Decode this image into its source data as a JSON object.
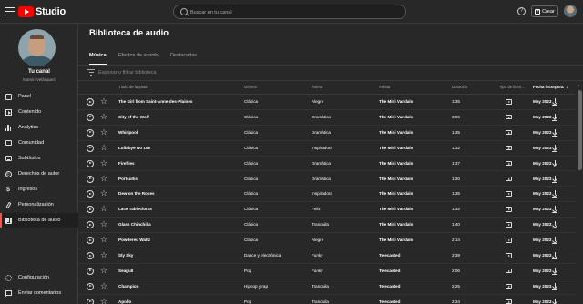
{
  "app": {
    "logo_text": "Studio",
    "search_placeholder": "Buscar en tu canal",
    "help_glyph": "?",
    "create_label": "Crear"
  },
  "channel": {
    "name": "Tu canal",
    "handle": "Marvin Velásquez"
  },
  "sidebar": {
    "items": [
      {
        "label": "Panel",
        "icon": "dashboard-icon"
      },
      {
        "label": "Contenido",
        "icon": "content-icon"
      },
      {
        "label": "Analytics",
        "icon": "analytics-icon"
      },
      {
        "label": "Comunidad",
        "icon": "community-icon"
      },
      {
        "label": "Subtítulos",
        "icon": "subtitles-icon"
      },
      {
        "label": "Derechos de autor",
        "icon": "copyright-icon"
      },
      {
        "label": "Ingresos",
        "icon": "earn-icon"
      },
      {
        "label": "Personalización",
        "icon": "customization-icon"
      },
      {
        "label": "Biblioteca de audio",
        "icon": "audio-library-icon",
        "active": true
      }
    ],
    "bottom": [
      {
        "label": "Configuración",
        "icon": "settings-icon"
      },
      {
        "label": "Enviar comentarios",
        "icon": "feedback-icon"
      }
    ]
  },
  "main": {
    "title": "Biblioteca de audio",
    "tabs": [
      {
        "label": "Música",
        "active": true
      },
      {
        "label": "Efectos de sonido"
      },
      {
        "label": "Destacadas"
      }
    ],
    "filter_placeholder": "Explorar o filtrar biblioteca",
    "columns": {
      "title": "Título de la pista",
      "genre": "Género",
      "mood": "Ánimo",
      "artist": "Artista",
      "duration": "Duración",
      "type": "Tipo de licen...",
      "date": "Fecha incorpora...",
      "sort_glyph": "↓"
    },
    "tracks": [
      {
        "title": "The Girl from Saint-Anne-des-Plaines",
        "genre": "Clásica",
        "mood": "Alegre",
        "artist": "The Mini Vandals",
        "duration": "1:35",
        "date": "May 2023"
      },
      {
        "title": "City of the Wolf",
        "genre": "Clásica",
        "mood": "Dramática",
        "artist": "The Mini Vandals",
        "duration": "3:06",
        "date": "May 2023"
      },
      {
        "title": "Whirlpool",
        "genre": "Clásica",
        "mood": "Dramática",
        "artist": "The Mini Vandals",
        "duration": "1:35",
        "date": "May 2023"
      },
      {
        "title": "Lullabye No 108",
        "genre": "Clásica",
        "mood": "Inspiradora",
        "artist": "The Mini Vandals",
        "duration": "1:32",
        "date": "May 2023"
      },
      {
        "title": "Fireflies",
        "genre": "Clásica",
        "mood": "Dramática",
        "artist": "The Mini Vandals",
        "duration": "1:37",
        "date": "May 2023"
      },
      {
        "title": "Portcullis",
        "genre": "Clásica",
        "mood": "Dramática",
        "artist": "The Mini Vandals",
        "duration": "1:30",
        "date": "May 2023"
      },
      {
        "title": "Dew on the Roses",
        "genre": "Clásica",
        "mood": "Inspiradora",
        "artist": "The Mini Vandals",
        "duration": "1:35",
        "date": "May 2023"
      },
      {
        "title": "Lace Tablecloths",
        "genre": "Clásica",
        "mood": "Feliz",
        "artist": "The Mini Vandals",
        "duration": "1:32",
        "date": "May 2023"
      },
      {
        "title": "Glass Chinchilla",
        "genre": "Clásica",
        "mood": "Tranquila",
        "artist": "The Mini Vandals",
        "duration": "1:40",
        "date": "May 2023"
      },
      {
        "title": "Powdered Waltz",
        "genre": "Clásica",
        "mood": "Alegre",
        "artist": "The Mini Vandals",
        "duration": "2:14",
        "date": "May 2023"
      },
      {
        "title": "Sly Sky",
        "genre": "Dance y electrónica",
        "mood": "Funky",
        "artist": "Telecasted",
        "duration": "2:39",
        "date": "May 2023"
      },
      {
        "title": "Seagull",
        "genre": "Pop",
        "mood": "Funky",
        "artist": "Telecasted",
        "duration": "2:06",
        "date": "May 2023"
      },
      {
        "title": "Champion",
        "genre": "Hiphop y rap",
        "mood": "Tranquila",
        "artist": "Telecasted",
        "duration": "2:25",
        "date": "May 2023"
      },
      {
        "title": "Apollo",
        "genre": "Pop",
        "mood": "Tranquila",
        "artist": "Telecasted",
        "duration": "2:34",
        "date": "May 2023"
      }
    ]
  },
  "colors": {
    "accent": "#ff4e45",
    "brand": "#ff0000",
    "background": "#282828"
  }
}
